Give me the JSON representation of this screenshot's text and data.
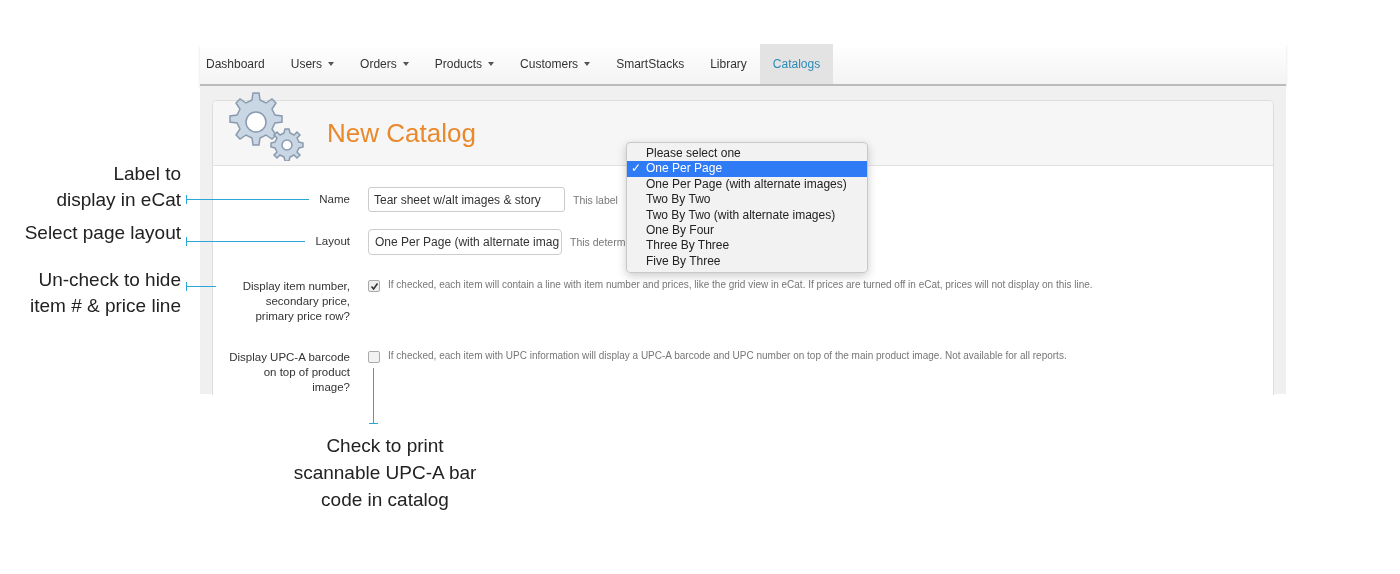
{
  "nav": {
    "tabs": [
      {
        "label": "Dashboard",
        "dropdown": false,
        "selected": false
      },
      {
        "label": "Users",
        "dropdown": true,
        "selected": false
      },
      {
        "label": "Orders",
        "dropdown": true,
        "selected": false
      },
      {
        "label": "Products",
        "dropdown": true,
        "selected": false
      },
      {
        "label": "Customers",
        "dropdown": true,
        "selected": false
      },
      {
        "label": "SmartStacks",
        "dropdown": false,
        "selected": false
      },
      {
        "label": "Library",
        "dropdown": false,
        "selected": false
      },
      {
        "label": "Catalogs",
        "dropdown": false,
        "selected": true
      }
    ]
  },
  "panel": {
    "title": "New Catalog"
  },
  "fields": [
    {
      "kind": "text",
      "label": "Name",
      "value": "Tear sheet w/alt images & story",
      "help": "This label",
      "callout": "Label to\ndisplay in eCat"
    },
    {
      "kind": "select",
      "label": "Layout",
      "value": "One Per Page (with alternate imag",
      "help": "This determ",
      "callout": "Select page layout"
    },
    {
      "kind": "checkbox",
      "label": "Display item number, secondary price, primary price row?",
      "checked": true,
      "help": "If checked, each item will contain a line with item number and prices, like the grid view in eCat. If prices are turned off in eCat, prices will not display on this line.",
      "callout": "Un-check to hide\nitem # & price line"
    },
    {
      "kind": "checkbox",
      "label": "Display UPC-A barcode on top of product image?",
      "checked": false,
      "help": "If checked, each item with UPC information will display a UPC-A barcode and UPC number on top of the main product image. Not available for all reports."
    }
  ],
  "bottom_callout": "Check to print\nscannable UPC-A bar\ncode in catalog",
  "dropdown": {
    "check_mark": "✓",
    "options": [
      {
        "label": "Please select one",
        "selected": false
      },
      {
        "label": "One Per Page",
        "selected": true
      },
      {
        "label": "One Per Page (with alternate images)",
        "selected": false
      },
      {
        "label": "Two By Two",
        "selected": false
      },
      {
        "label": "Two By Two (with alternate images)",
        "selected": false
      },
      {
        "label": "One By Four",
        "selected": false
      },
      {
        "label": "Three By Three",
        "selected": false
      },
      {
        "label": "Five By Three",
        "selected": false
      }
    ]
  }
}
